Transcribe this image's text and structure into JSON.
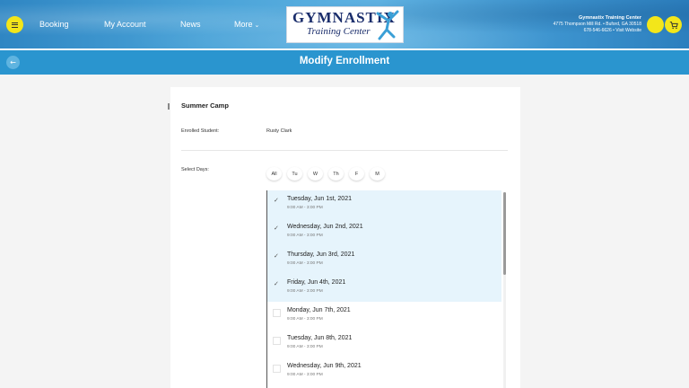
{
  "header": {
    "nav": [
      "Booking",
      "My Account",
      "News",
      "More"
    ],
    "logo_top": "GYMNASTIX",
    "logo_bottom": "Training Center",
    "business_name": "Gymnastix Training Center",
    "business_address": "4775 Thompson Mill Rd. • Buford, GA 30518",
    "business_contact": "678-546-6626 • Visit Website",
    "icons": {
      "menu": "menu-icon",
      "more": "chevron-down-icon",
      "avatar": "user-icon",
      "cart": "cart-icon"
    },
    "colors": {
      "accent": "#f3e61a",
      "header": "#3d94cf"
    }
  },
  "titlebar": {
    "title": "Modify Enrollment",
    "back_icon": "arrow-left-icon",
    "color": "#2a95cf"
  },
  "enrollment": {
    "camp_title": "Summer Camp",
    "enrolled_label": "Enrolled Student:",
    "enrolled_value": "Rusty Clark",
    "select_days_label": "Select Days:",
    "day_filters": [
      "All",
      "Tu",
      "W",
      "Th",
      "F",
      "M"
    ],
    "dates": [
      {
        "date": "Tuesday, Jun 1st, 2021",
        "time": "9:00 AM - 3:00 PM",
        "selected": true
      },
      {
        "date": "Wednesday, Jun 2nd, 2021",
        "time": "9:00 AM - 3:00 PM",
        "selected": true
      },
      {
        "date": "Thursday, Jun 3rd, 2021",
        "time": "9:00 AM - 3:00 PM",
        "selected": true
      },
      {
        "date": "Friday, Jun 4th, 2021",
        "time": "9:00 AM - 3:00 PM",
        "selected": true
      },
      {
        "date": "Monday, Jun 7th, 2021",
        "time": "9:00 AM - 3:00 PM",
        "selected": false
      },
      {
        "date": "Tuesday, Jun 8th, 2021",
        "time": "9:00 AM - 3:00 PM",
        "selected": false
      },
      {
        "date": "Wednesday, Jun 9th, 2021",
        "time": "9:00 AM - 3:00 PM",
        "selected": false
      }
    ]
  }
}
